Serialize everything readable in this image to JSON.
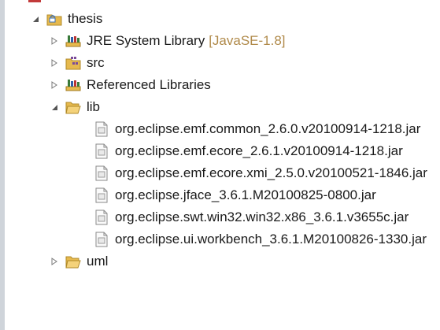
{
  "tree": {
    "project": {
      "label": "thesis",
      "expanded": true,
      "icon": "java-project-icon",
      "children": [
        {
          "label": "JRE System Library",
          "decoration": "[JavaSE-1.8]",
          "icon": "library-icon",
          "expanded": false
        },
        {
          "label": "src",
          "icon": "source-folder-icon",
          "expanded": false
        },
        {
          "label": "Referenced Libraries",
          "icon": "library-icon",
          "expanded": false
        },
        {
          "label": "lib",
          "icon": "folder-open-icon",
          "expanded": true,
          "children": [
            {
              "label": "org.eclipse.emf.common_2.6.0.v20100914-1218.jar",
              "icon": "jar-file-icon"
            },
            {
              "label": "org.eclipse.emf.ecore_2.6.1.v20100914-1218.jar",
              "icon": "jar-file-icon"
            },
            {
              "label": "org.eclipse.emf.ecore.xmi_2.5.0.v20100521-1846.jar",
              "icon": "jar-file-icon"
            },
            {
              "label": "org.eclipse.jface_3.6.1.M20100825-0800.jar",
              "icon": "jar-file-icon"
            },
            {
              "label": "org.eclipse.swt.win32.win32.x86_3.6.1.v3655c.jar",
              "icon": "jar-file-icon"
            },
            {
              "label": "org.eclipse.ui.workbench_3.6.1.M20100826-1330.jar",
              "icon": "jar-file-icon"
            }
          ]
        },
        {
          "label": "uml",
          "icon": "folder-icon",
          "expanded": false
        }
      ]
    }
  },
  "colors": {
    "folder": "#e6b94e",
    "library_books": "#3a7a3a",
    "decoration": "#b08a4a",
    "twisty": "#555555"
  }
}
